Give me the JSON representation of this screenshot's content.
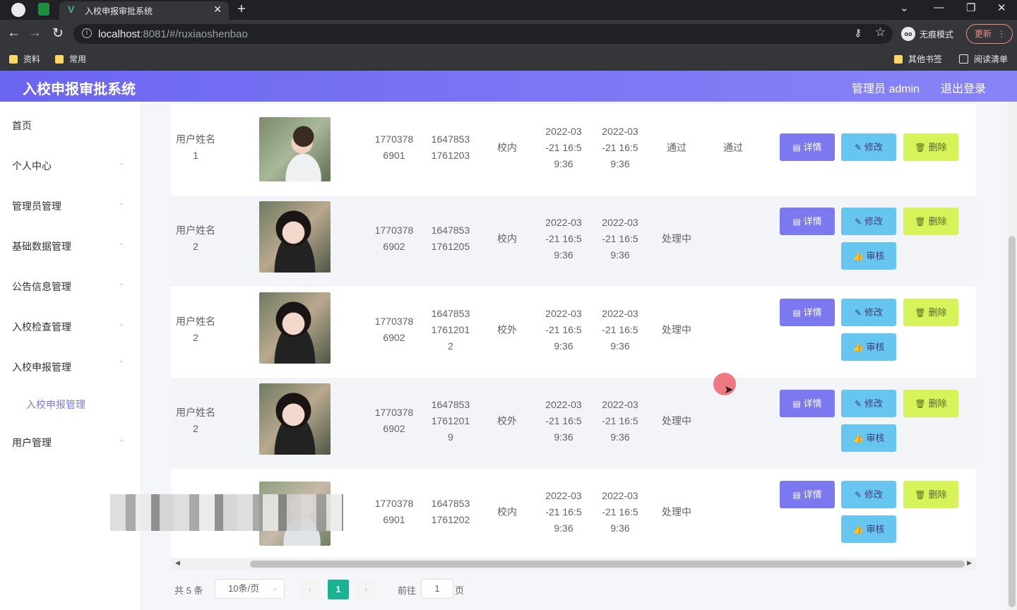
{
  "browser": {
    "tab_title": "入校申报审批系统",
    "url_host": "localhost",
    "url_rest": ":8081/#/ruxiaoshenbao",
    "incognito_label": "无痕模式",
    "update_label": "更新",
    "bookmarks": [
      "资料",
      "常用"
    ],
    "bookmarks_right": [
      "其他书签",
      "阅读清单"
    ]
  },
  "app": {
    "title": "入校申报审批系统",
    "admin": "管理员 admin",
    "logout": "退出登录"
  },
  "sidebar": {
    "items": [
      {
        "label": "首页"
      },
      {
        "label": "个人中心"
      },
      {
        "label": "管理员管理"
      },
      {
        "label": "基础数据管理"
      },
      {
        "label": "公告信息管理"
      },
      {
        "label": "入校检查管理"
      },
      {
        "label": "入校申报管理"
      },
      {
        "label": "用户管理"
      }
    ],
    "submenu": "入校申报管理"
  },
  "actions": {
    "detail": "详情",
    "edit": "修改",
    "delete": "删除",
    "audit": "审核"
  },
  "rows": [
    {
      "name": "用户姓名\n1",
      "phone": "1770378\n6901",
      "code": "1647853\n1761203",
      "location": "校内",
      "time1": "2022-03\n-21 16:5\n9:36",
      "time2": "2022-03\n-21 16:5\n9:36",
      "status": "通过",
      "result": "通过"
    },
    {
      "name": "用户姓名\n2",
      "phone": "1770378\n6902",
      "code": "1647853\n1761205",
      "location": "校内",
      "time1": "2022-03\n-21 16:5\n9:36",
      "time2": "2022-03\n-21 16:5\n9:36",
      "status": "处理中",
      "result": ""
    },
    {
      "name": "用户姓名\n2",
      "phone": "1770378\n6902",
      "code": "1647853\n1761201\n2",
      "location": "校外",
      "time1": "2022-03\n-21 16:5\n9:36",
      "time2": "2022-03\n-21 16:5\n9:36",
      "status": "处理中",
      "result": ""
    },
    {
      "name": "用户姓名\n2",
      "phone": "1770378\n6902",
      "code": "1647853\n1761201\n9",
      "location": "校外",
      "time1": "2022-03\n-21 16:5\n9:36",
      "time2": "2022-03\n-21 16:5\n9:36",
      "status": "处理中",
      "result": ""
    },
    {
      "name": "",
      "phone": "1770378\n6901",
      "code": "1647853\n1761202",
      "location": "校内",
      "time1": "2022-03\n-21 16:5\n9:36",
      "time2": "2022-03\n-21 16:5\n9:36",
      "status": "处理中",
      "result": ""
    }
  ],
  "pagination": {
    "total": "共 5 条",
    "page_size": "10条/页",
    "current": "1",
    "goto": "前往",
    "goto_value": "1",
    "page_suffix": "页"
  }
}
